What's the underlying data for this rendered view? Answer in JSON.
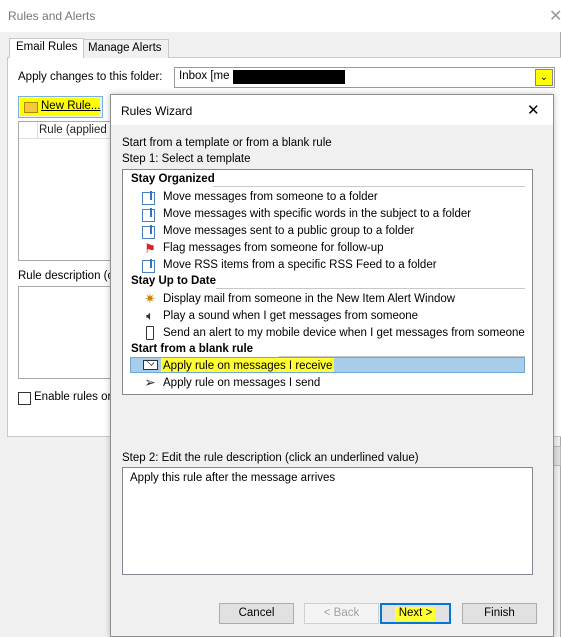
{
  "background_dialog": {
    "title": "Rules and Alerts",
    "close_glyph": "✕",
    "tabs": [
      "Email Rules",
      "Manage Alerts"
    ],
    "apply_changes_label": "Apply changes to this folder:",
    "folder_value": "Inbox [me",
    "folder_dropdown_glyph": "⌄",
    "new_rule_label": "New Rule...",
    "rules_column_header": "Rule (applied in",
    "rule_description_label": "Rule description (c",
    "enable_rules_label": "Enable rules or"
  },
  "wizard": {
    "title": "Rules Wizard",
    "close_glyph": "✕",
    "intro": "Start from a template or from a blank rule",
    "step1_label": "Step 1: Select a template",
    "sections": [
      {
        "heading": "Stay Organized",
        "items": [
          {
            "label": "Move messages from someone to a folder",
            "icon": "move-to-folder-icon"
          },
          {
            "label": "Move messages with specific words in the subject to a folder",
            "icon": "move-to-folder-icon"
          },
          {
            "label": "Move messages sent to a public group to a folder",
            "icon": "move-to-folder-icon"
          },
          {
            "label": "Flag messages from someone for follow-up",
            "icon": "flag-icon"
          },
          {
            "label": "Move RSS items from a specific RSS Feed to a folder",
            "icon": "move-to-folder-icon"
          }
        ]
      },
      {
        "heading": "Stay Up to Date",
        "items": [
          {
            "label": "Display mail from someone in the New Item Alert Window",
            "icon": "alert-window-icon"
          },
          {
            "label": "Play a sound when I get messages from someone",
            "icon": "speaker-icon"
          },
          {
            "label": "Send an alert to my mobile device when I get messages from someone",
            "icon": "mobile-device-icon"
          }
        ]
      },
      {
        "heading": "Start from a blank rule",
        "items": [
          {
            "label": "Apply rule on messages I receive",
            "icon": "envelope-icon",
            "selected": true
          },
          {
            "label": "Apply rule on messages I send",
            "icon": "send-arrow-icon"
          }
        ]
      }
    ],
    "step2_label": "Step 2: Edit the rule description (click an underlined value)",
    "rule_description": "Apply this rule after the message arrives",
    "buttons": {
      "cancel": "Cancel",
      "back": "< Back",
      "next": "Next >",
      "finish": "Finish"
    },
    "highlight_color": "#ffff00",
    "selection_color": "#a8cdea"
  }
}
